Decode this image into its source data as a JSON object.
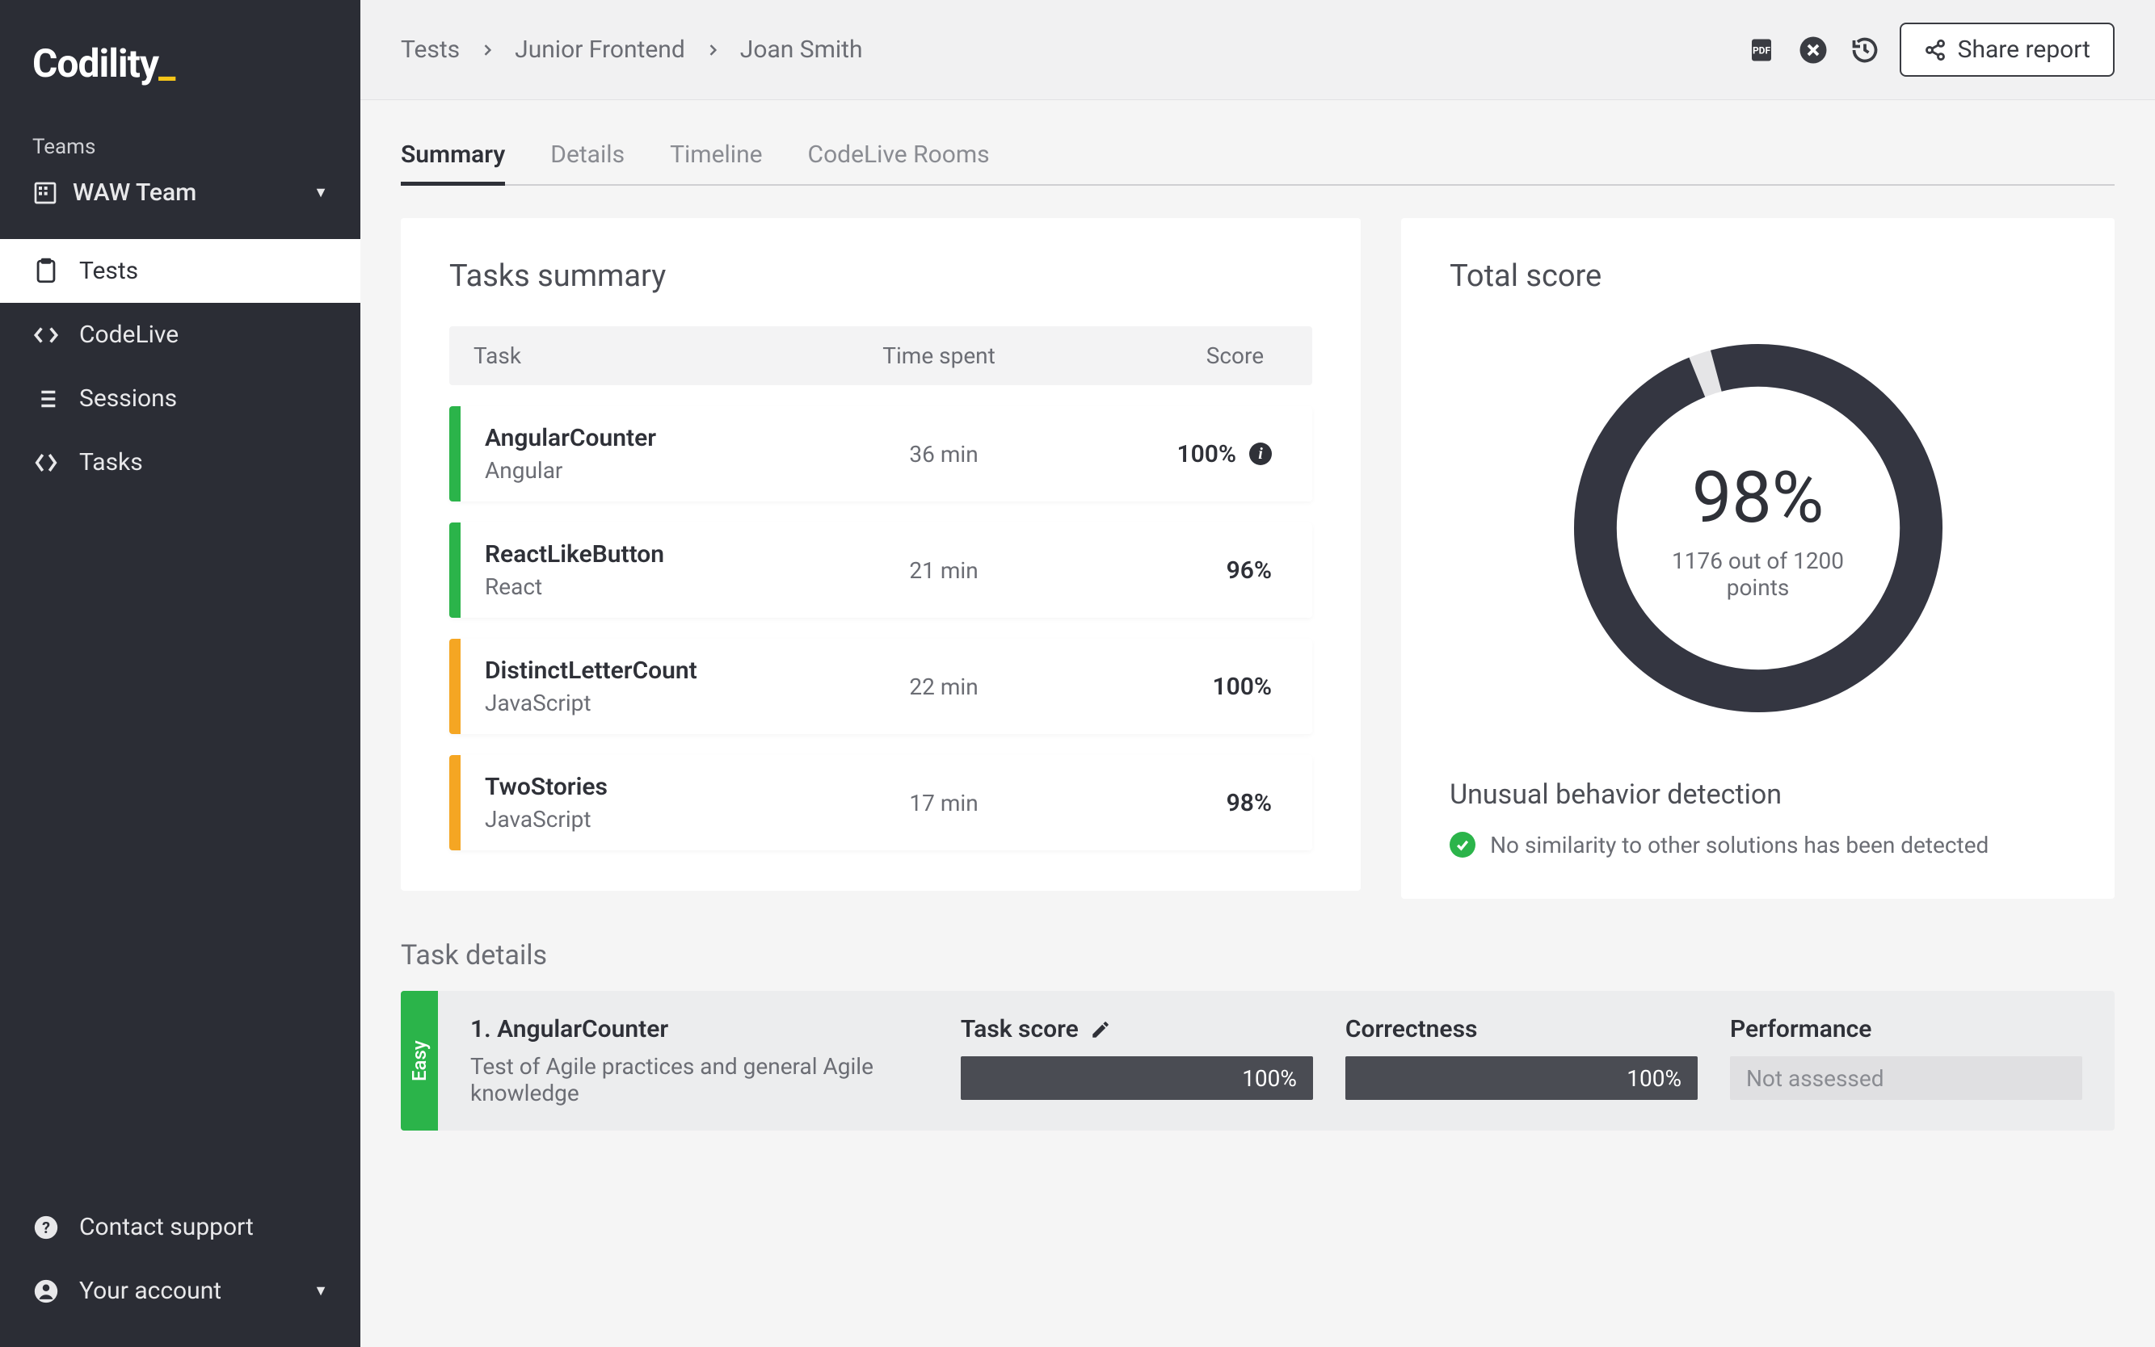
{
  "brand": {
    "name": "Codility",
    "caret": "_"
  },
  "sidebar": {
    "teams_label": "Teams",
    "team_name": "WAW Team",
    "nav": [
      {
        "label": "Tests"
      },
      {
        "label": "CodeLive"
      },
      {
        "label": "Sessions"
      },
      {
        "label": "Tasks"
      }
    ],
    "bottom": {
      "support": "Contact support",
      "account": "Your account"
    }
  },
  "breadcrumb": [
    "Tests",
    "Junior Frontend",
    "Joan Smith"
  ],
  "actions": {
    "share": "Share report"
  },
  "tabs": [
    "Summary",
    "Details",
    "Timeline",
    "CodeLive Rooms"
  ],
  "tasks_summary": {
    "title": "Tasks summary",
    "headers": {
      "task": "Task",
      "time": "Time spent",
      "score": "Score"
    },
    "rows": [
      {
        "name": "AngularCounter",
        "lang": "Angular",
        "time": "36 min",
        "score": "100%",
        "info": true,
        "color": "green"
      },
      {
        "name": "ReactLikeButton",
        "lang": "React",
        "time": "21 min",
        "score": "96%",
        "info": false,
        "color": "green"
      },
      {
        "name": "DistinctLetterCount",
        "lang": "JavaScript",
        "time": "22 min",
        "score": "100%",
        "info": false,
        "color": "amber"
      },
      {
        "name": "TwoStories",
        "lang": "JavaScript",
        "time": "17 min",
        "score": "98%",
        "info": false,
        "color": "amber"
      }
    ]
  },
  "total_score": {
    "title": "Total score",
    "percent_value": 98,
    "percent_label": "98%",
    "subtext": "1176 out of 1200 points"
  },
  "ubd": {
    "title": "Unusual behavior detection",
    "message": "No similarity to other solutions has been detected"
  },
  "task_details": {
    "heading": "Task details",
    "difficulty": "Easy",
    "title": "1. AngularCounter",
    "desc": "Test of Agile practices and general Agile knowledge",
    "metrics": {
      "task_score": {
        "label": "Task score",
        "value": "100%"
      },
      "correctness": {
        "label": "Correctness",
        "value": "100%"
      },
      "performance": {
        "label": "Performance",
        "value": "Not assessed"
      }
    }
  },
  "chart_data": {
    "type": "pie",
    "title": "Total score",
    "values": [
      98,
      2
    ],
    "categories": [
      "score",
      "remaining"
    ],
    "colors": [
      "#343641",
      "#e5e5e7"
    ]
  }
}
